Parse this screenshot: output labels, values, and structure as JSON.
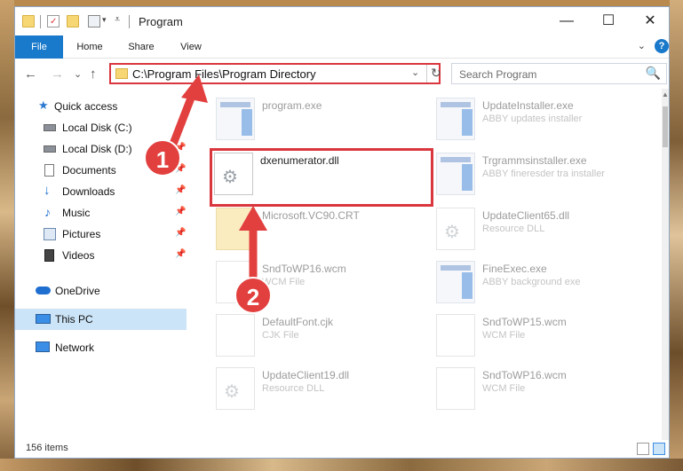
{
  "window": {
    "title": "Program",
    "controls": {
      "minimize": "—",
      "maximize": "☐",
      "close": "✕"
    }
  },
  "ribbon": {
    "tabs": [
      "File",
      "Home",
      "Share",
      "View"
    ],
    "help": "?"
  },
  "address_bar": {
    "path": "C:\\Program Files\\Program Directory",
    "dropdown": "⌄",
    "refresh": "↻"
  },
  "search": {
    "placeholder": "Search Program",
    "icon": "🔍"
  },
  "nav": {
    "back": "←",
    "forward": "→",
    "recent": "⌄",
    "up": "↑"
  },
  "sidebar": {
    "items": [
      {
        "label": "Quick access",
        "icon": "star-icon"
      },
      {
        "label": "Local Disk (C:)",
        "icon": "drive-icon",
        "pinned": true
      },
      {
        "label": "Local Disk (D:)",
        "icon": "drive-icon",
        "pinned": true
      },
      {
        "label": "Documents",
        "icon": "documents-icon",
        "pinned": true
      },
      {
        "label": "Downloads",
        "icon": "download-icon",
        "pinned": true
      },
      {
        "label": "Music",
        "icon": "music-icon",
        "pinned": true
      },
      {
        "label": "Pictures",
        "icon": "pictures-icon",
        "pinned": true
      },
      {
        "label": "Videos",
        "icon": "videos-icon",
        "pinned": true
      },
      {
        "label": "OneDrive",
        "icon": "cloud-icon"
      },
      {
        "label": "This PC",
        "icon": "computer-icon",
        "selected": true
      },
      {
        "label": "Network",
        "icon": "network-icon"
      }
    ]
  },
  "files": [
    {
      "name": "program.exe",
      "type": "",
      "thumb": "exe"
    },
    {
      "name": "UpdateInstaller.exe",
      "type": "ABBY updates installer",
      "thumb": "exe"
    },
    {
      "name": "dxenumerator.dll",
      "type": "",
      "thumb": "dll",
      "highlighted": true
    },
    {
      "name": "Trgrammsinstaller.exe",
      "type": "ABBY fineresder tra installer",
      "thumb": "exe"
    },
    {
      "name": "Microsoft.VC90.CRT",
      "type": "",
      "thumb": "folder"
    },
    {
      "name": "UpdateClient65.dll",
      "type": "Resource DLL",
      "thumb": "dll"
    },
    {
      "name": "SndToWP16.wcm",
      "type": "WCM File",
      "thumb": "doc"
    },
    {
      "name": "FineExec.exe",
      "type": "ABBY background exe",
      "thumb": "exe"
    },
    {
      "name": "DefaultFont.cjk",
      "type": "CJK File",
      "thumb": "doc"
    },
    {
      "name": "SndToWP15.wcm",
      "type": "WCM File",
      "thumb": "doc"
    },
    {
      "name": "UpdateClient19.dll",
      "type": "Resource DLL",
      "thumb": "dll"
    },
    {
      "name": "SndToWP16.wcm",
      "type": "WCM File",
      "thumb": "doc"
    }
  ],
  "status": {
    "count": "156 items"
  },
  "annotations": {
    "step1": "1",
    "step2": "2"
  },
  "colors": {
    "accent": "#1979ca",
    "highlight": "#d9363e",
    "badge": "#e2403f",
    "selected": "#cce4f7"
  }
}
